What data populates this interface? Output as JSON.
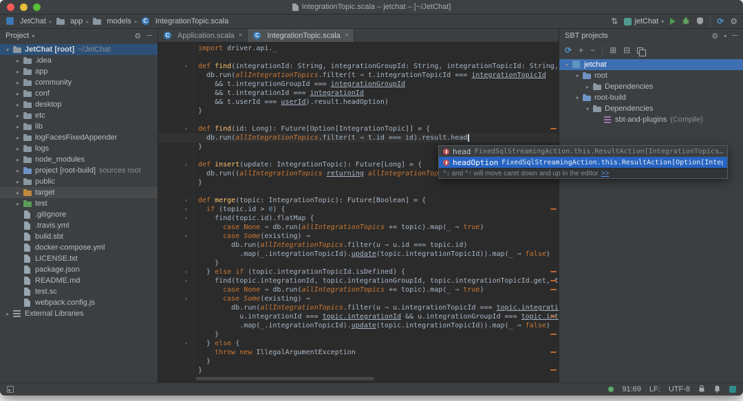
{
  "window": {
    "title": "IntegrationTopic.scala – jetchat – [~/JetChat]"
  },
  "navbar": {
    "breadcrumbs": [
      {
        "label": "JetChat",
        "icon": "project"
      },
      {
        "label": "app",
        "icon": "folder"
      },
      {
        "label": "models",
        "icon": "folder"
      },
      {
        "label": "IntegrationTopic.scala",
        "icon": "scala-file"
      }
    ],
    "run_config": "jetChat"
  },
  "project_panel": {
    "title": "Project",
    "items": [
      {
        "label": "JetChat [root]",
        "sub": "~/JetChat",
        "icon": "folder",
        "depth": 0,
        "children": "expanded",
        "selected": true,
        "bold": true
      },
      {
        "label": ".idea",
        "icon": "folder",
        "depth": 1,
        "children": "collapsed"
      },
      {
        "label": "app",
        "icon": "folder",
        "depth": 1,
        "children": "collapsed"
      },
      {
        "label": "community",
        "icon": "folder",
        "depth": 1,
        "children": "collapsed"
      },
      {
        "label": "conf",
        "icon": "folder",
        "depth": 1,
        "children": "collapsed"
      },
      {
        "label": "desktop",
        "icon": "folder",
        "depth": 1,
        "children": "collapsed"
      },
      {
        "label": "etc",
        "icon": "folder",
        "depth": 1,
        "children": "collapsed"
      },
      {
        "label": "lib",
        "icon": "folder",
        "depth": 1,
        "children": "collapsed"
      },
      {
        "label": "logFacesFixedAppender",
        "icon": "folder",
        "depth": 1,
        "children": "collapsed"
      },
      {
        "label": "logs",
        "icon": "folder",
        "depth": 1,
        "children": "collapsed"
      },
      {
        "label": "node_modules",
        "icon": "folder",
        "depth": 1,
        "children": "collapsed"
      },
      {
        "label": "project [root-build]",
        "sub": "sources root",
        "icon": "folder-src",
        "depth": 1,
        "children": "collapsed"
      },
      {
        "label": "public",
        "icon": "folder",
        "depth": 1,
        "children": "collapsed"
      },
      {
        "label": "target",
        "icon": "folder-excluded",
        "depth": 1,
        "children": "collapsed",
        "hover": true
      },
      {
        "label": "test",
        "icon": "folder-test",
        "depth": 1,
        "children": "collapsed"
      },
      {
        "label": ".gitignore",
        "icon": "file",
        "depth": 1
      },
      {
        "label": ".travis.yml",
        "icon": "file",
        "depth": 1
      },
      {
        "label": "build.sbt",
        "icon": "file",
        "depth": 1
      },
      {
        "label": "docker-compose.yml",
        "icon": "file",
        "depth": 1
      },
      {
        "label": "LICENSE.txt",
        "icon": "file",
        "depth": 1
      },
      {
        "label": "package.json",
        "icon": "file",
        "depth": 1
      },
      {
        "label": "README.md",
        "icon": "file",
        "depth": 1
      },
      {
        "label": "test.sc",
        "icon": "file",
        "depth": 1
      },
      {
        "label": "webpack.config.js",
        "icon": "file",
        "depth": 1
      },
      {
        "label": "External Libraries",
        "icon": "libs",
        "depth": 0,
        "children": "collapsed"
      }
    ]
  },
  "tabs": [
    {
      "label": "Application.scala",
      "icon": "scala-class",
      "active": false
    },
    {
      "label": "IntegrationTopic.scala",
      "icon": "scala-class",
      "active": true
    }
  ],
  "editor": {
    "lines": [
      {
        "t": [
          [
            "k",
            "import"
          ],
          [
            "p",
            " driver.api._"
          ]
        ]
      },
      {
        "t": []
      },
      {
        "t": [
          [
            "k",
            "def"
          ],
          [
            "p",
            " "
          ],
          [
            "fn",
            "find"
          ],
          [
            "p",
            "(integrationId: String, integrationGroupId: String, integrationTopicId: String, u"
          ]
        ],
        "fold": true
      },
      {
        "t": [
          [
            "p",
            "  db.run("
          ],
          [
            "it",
            "allIntegrationTopics"
          ],
          [
            "p",
            ".filter(t ⇒ t.integrationTopicId === "
          ],
          [
            "u",
            "integrationTopicId"
          ]
        ]
      },
      {
        "t": [
          [
            "p",
            "    && t.integrationGroupId === "
          ],
          [
            "u",
            "integrationGroupId"
          ]
        ]
      },
      {
        "t": [
          [
            "p",
            "    && t.integrationId === "
          ],
          [
            "u",
            "integrationId"
          ]
        ]
      },
      {
        "t": [
          [
            "p",
            "    && t.userId === "
          ],
          [
            "u",
            "userId"
          ],
          [
            "p",
            ").result.headOption)"
          ]
        ]
      },
      {
        "t": [
          [
            "p",
            "}"
          ]
        ]
      },
      {
        "t": []
      },
      {
        "t": [
          [
            "k",
            "def"
          ],
          [
            "p",
            " "
          ],
          [
            "fn",
            "find"
          ],
          [
            "p",
            "(id: Long): Future[Option[IntegrationTopic]] = {"
          ]
        ],
        "fold": true,
        "mark": true
      },
      {
        "t": [
          [
            "p",
            "  db.run("
          ],
          [
            "it",
            "allIntegrationTopics"
          ],
          [
            "p",
            ".filter(t ⇒ t.id === id).result.head"
          ]
        ],
        "caret": true,
        "cur": true
      },
      {
        "t": [
          [
            "p",
            "}"
          ]
        ]
      },
      {
        "t": []
      },
      {
        "t": [
          [
            "k",
            "def"
          ],
          [
            "p",
            " "
          ],
          [
            "fn",
            "insert"
          ],
          [
            "p",
            "(update: IntegrationTopic): Future[Long] = {"
          ]
        ],
        "fold": true,
        "mark": true
      },
      {
        "t": [
          [
            "p",
            "  db.run(("
          ],
          [
            "it",
            "allIntegrationTopics"
          ],
          [
            "p",
            " "
          ],
          [
            "u",
            "returning"
          ],
          [
            "p",
            " "
          ],
          [
            "it",
            "allIntegrationTopics"
          ],
          [
            "p",
            ".map(_.id)) += "
          ],
          [
            "u",
            "update"
          ],
          [
            "p",
            ")"
          ]
        ]
      },
      {
        "t": [
          [
            "p",
            "}"
          ]
        ]
      },
      {
        "t": []
      },
      {
        "t": [
          [
            "k",
            "def"
          ],
          [
            "p",
            " "
          ],
          [
            "fn",
            "merge"
          ],
          [
            "p",
            "(topic: IntegrationTopic): Future[Boolean] = {"
          ]
        ],
        "fold": true
      },
      {
        "t": [
          [
            "p",
            "  "
          ],
          [
            "k",
            "if"
          ],
          [
            "p",
            " (topic.id > "
          ],
          [
            "n",
            "0"
          ],
          [
            "p",
            ") {"
          ]
        ],
        "fold": true,
        "mark": true
      },
      {
        "t": [
          [
            "p",
            "    find(topic.id).flatMap {"
          ]
        ],
        "fold": true
      },
      {
        "t": [
          [
            "p",
            "      "
          ],
          [
            "k",
            "case"
          ],
          [
            "p",
            " "
          ],
          [
            "k",
            "None"
          ],
          [
            "p",
            " ⇒ db.run("
          ],
          [
            "it",
            "allIntegrationTopics"
          ],
          [
            "p",
            " += topic).map(_ ⇒ "
          ],
          [
            "k",
            "true"
          ],
          [
            "p",
            ")"
          ]
        ]
      },
      {
        "t": [
          [
            "p",
            "      "
          ],
          [
            "k",
            "case"
          ],
          [
            "p",
            " "
          ],
          [
            "it",
            "Some"
          ],
          [
            "p",
            "(existing) ⇒"
          ]
        ],
        "fold": true
      },
      {
        "t": [
          [
            "p",
            "        db.run("
          ],
          [
            "it",
            "allIntegrationTopics"
          ],
          [
            "p",
            ".filter(u ⇒ u.id === topic.id)"
          ]
        ]
      },
      {
        "t": [
          [
            "p",
            "          .map(_.integrationTopicId)."
          ],
          [
            "u",
            "update"
          ],
          [
            "p",
            "(topic.integrationTopicId)).map(_ ⇒ "
          ],
          [
            "k",
            "false"
          ],
          [
            "p",
            ")"
          ]
        ]
      },
      {
        "t": [
          [
            "p",
            "    }"
          ]
        ]
      },
      {
        "t": [
          [
            "p",
            "  } "
          ],
          [
            "k",
            "else"
          ],
          [
            "p",
            " "
          ],
          [
            "k",
            "if"
          ],
          [
            "p",
            " (topic.integrationTopicId.isDefined) {"
          ]
        ],
        "fold": true,
        "mark": true
      },
      {
        "t": [
          [
            "p",
            "    find(topic.integrationId, topic.integrationGroupId, topic.integrationTopicId.get, top"
          ]
        ],
        "fold": true,
        "mark": true
      },
      {
        "t": [
          [
            "p",
            "      "
          ],
          [
            "k",
            "case"
          ],
          [
            "p",
            " "
          ],
          [
            "k",
            "None"
          ],
          [
            "p",
            " ⇒ db.run("
          ],
          [
            "it",
            "allIntegrationTopics"
          ],
          [
            "p",
            " += topic).map(_ ⇒ "
          ],
          [
            "k",
            "true"
          ],
          [
            "p",
            ")"
          ]
        ],
        "mark": true
      },
      {
        "t": [
          [
            "p",
            "      "
          ],
          [
            "k",
            "case"
          ],
          [
            "p",
            " "
          ],
          [
            "it",
            "Some"
          ],
          [
            "p",
            "(existing) ⇒"
          ]
        ],
        "fold": true
      },
      {
        "t": [
          [
            "p",
            "        db.run("
          ],
          [
            "it",
            "allIntegrationTopics"
          ],
          [
            "p",
            ".filter(u ⇒ u.integrationTopicId === "
          ],
          [
            "u",
            "topic.integratio"
          ]
        ]
      },
      {
        "t": [
          [
            "p",
            "          u.integrationId === "
          ],
          [
            "u",
            "topic.integrationId"
          ],
          [
            "p",
            " && u.integrationGroupId === "
          ],
          [
            "u",
            "topic.integ"
          ]
        ],
        "mark": true
      },
      {
        "t": [
          [
            "p",
            "          .map(_.integrationTopicId)."
          ],
          [
            "u",
            "update"
          ],
          [
            "p",
            "(topic.integrationTopicId)).map(_ ⇒ "
          ],
          [
            "k",
            "false"
          ],
          [
            "p",
            ")"
          ]
        ]
      },
      {
        "t": [
          [
            "p",
            "    }"
          ]
        ],
        "mark": true
      },
      {
        "t": [
          [
            "p",
            "  } "
          ],
          [
            "k",
            "else"
          ],
          [
            "p",
            " {"
          ]
        ],
        "fold": true
      },
      {
        "t": [
          [
            "p",
            "    "
          ],
          [
            "k",
            "throw"
          ],
          [
            "p",
            " "
          ],
          [
            "k",
            "new"
          ],
          [
            "p",
            " IllegalArgumentException"
          ]
        ],
        "mark": true
      },
      {
        "t": [
          [
            "p",
            "  }"
          ]
        ]
      },
      {
        "t": [
          [
            "p",
            "}"
          ]
        ],
        "mark": true
      }
    ]
  },
  "completion": {
    "items": [
      {
        "name": "head",
        "type": "FixedSqlStreamingAction.this.ResultAction[IntegrationTopics…",
        "selected": false
      },
      {
        "name": "headOption",
        "type": "FixedSqlStreamingAction.this.ResultAction[Option[Integra…",
        "selected": true
      }
    ],
    "hint": "^↓ and ^↑ will move caret down and up in the editor",
    "hint_link": ">>"
  },
  "sbt_panel": {
    "title": "SBT projects",
    "tree": [
      {
        "label": "jetchat",
        "icon": "sbt-project",
        "depth": 0,
        "children": "expanded",
        "selected": true
      },
      {
        "label": "root",
        "icon": "module",
        "depth": 1,
        "children": "expanded"
      },
      {
        "label": "Dependencies",
        "icon": "folder",
        "depth": 2,
        "children": "collapsed"
      },
      {
        "label": "root-build",
        "icon": "module",
        "depth": 1,
        "children": "expanded"
      },
      {
        "label": "Dependencies",
        "icon": "folder",
        "depth": 2,
        "children": "expanded"
      },
      {
        "label": "sbt-and-plugins",
        "sub": "(Compile)",
        "icon": "library",
        "depth": 3
      }
    ]
  },
  "statusbar": {
    "position": "91:69",
    "line_sep": "LF:",
    "encoding": "UTF-8"
  }
}
